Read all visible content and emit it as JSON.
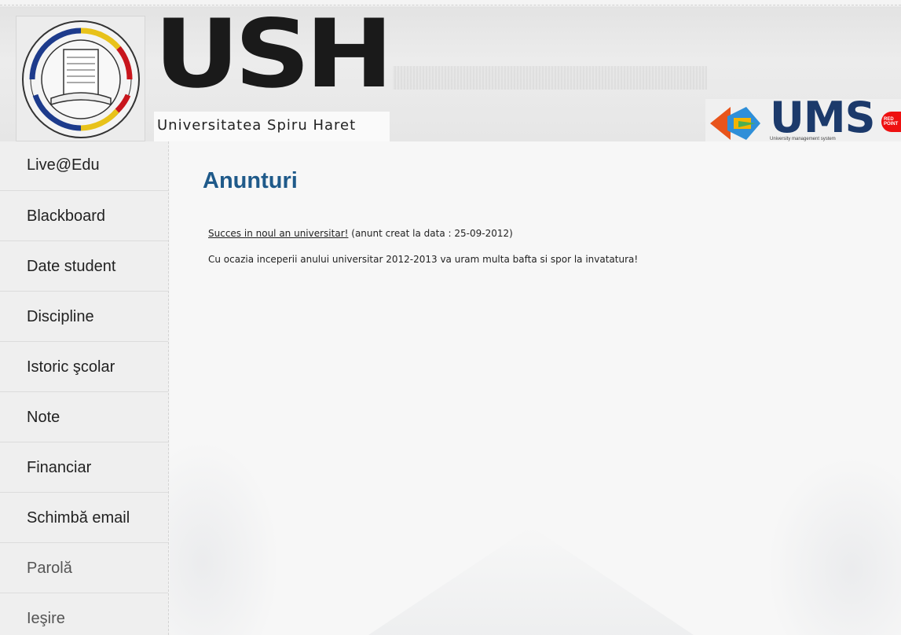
{
  "header": {
    "logo_text": "USH",
    "university_name": "Universitatea Spiru Haret",
    "seal_text": "FUNDATIA ROMANIA DE MAINE · UNIVERSITATEA SPIRU HARET",
    "ums_text": "UMS",
    "ums_subtitle": "University management system",
    "redpoint_text": "RED POINT"
  },
  "sidebar": {
    "items": [
      {
        "label": "Live@Edu"
      },
      {
        "label": "Blackboard"
      },
      {
        "label": "Date student"
      },
      {
        "label": "Discipline"
      },
      {
        "label": "Istoric şcolar"
      },
      {
        "label": "Note"
      },
      {
        "label": "Financiar"
      },
      {
        "label": "Schimbă email"
      },
      {
        "label": "Parolă"
      },
      {
        "label": "Ieşire"
      }
    ]
  },
  "main": {
    "title": "Anunturi",
    "announcement": {
      "title": "Succes in noul an universitar!",
      "meta": " (anunt creat la data : 25-09-2012)",
      "body": "Cu ocazia inceperii anului universitar 2012-2013 va uram multa bafta si spor la invatatura!"
    }
  },
  "colors": {
    "title": "#1f5a8a",
    "ums": "#1c3a6b",
    "redpoint": "#ee1111"
  }
}
